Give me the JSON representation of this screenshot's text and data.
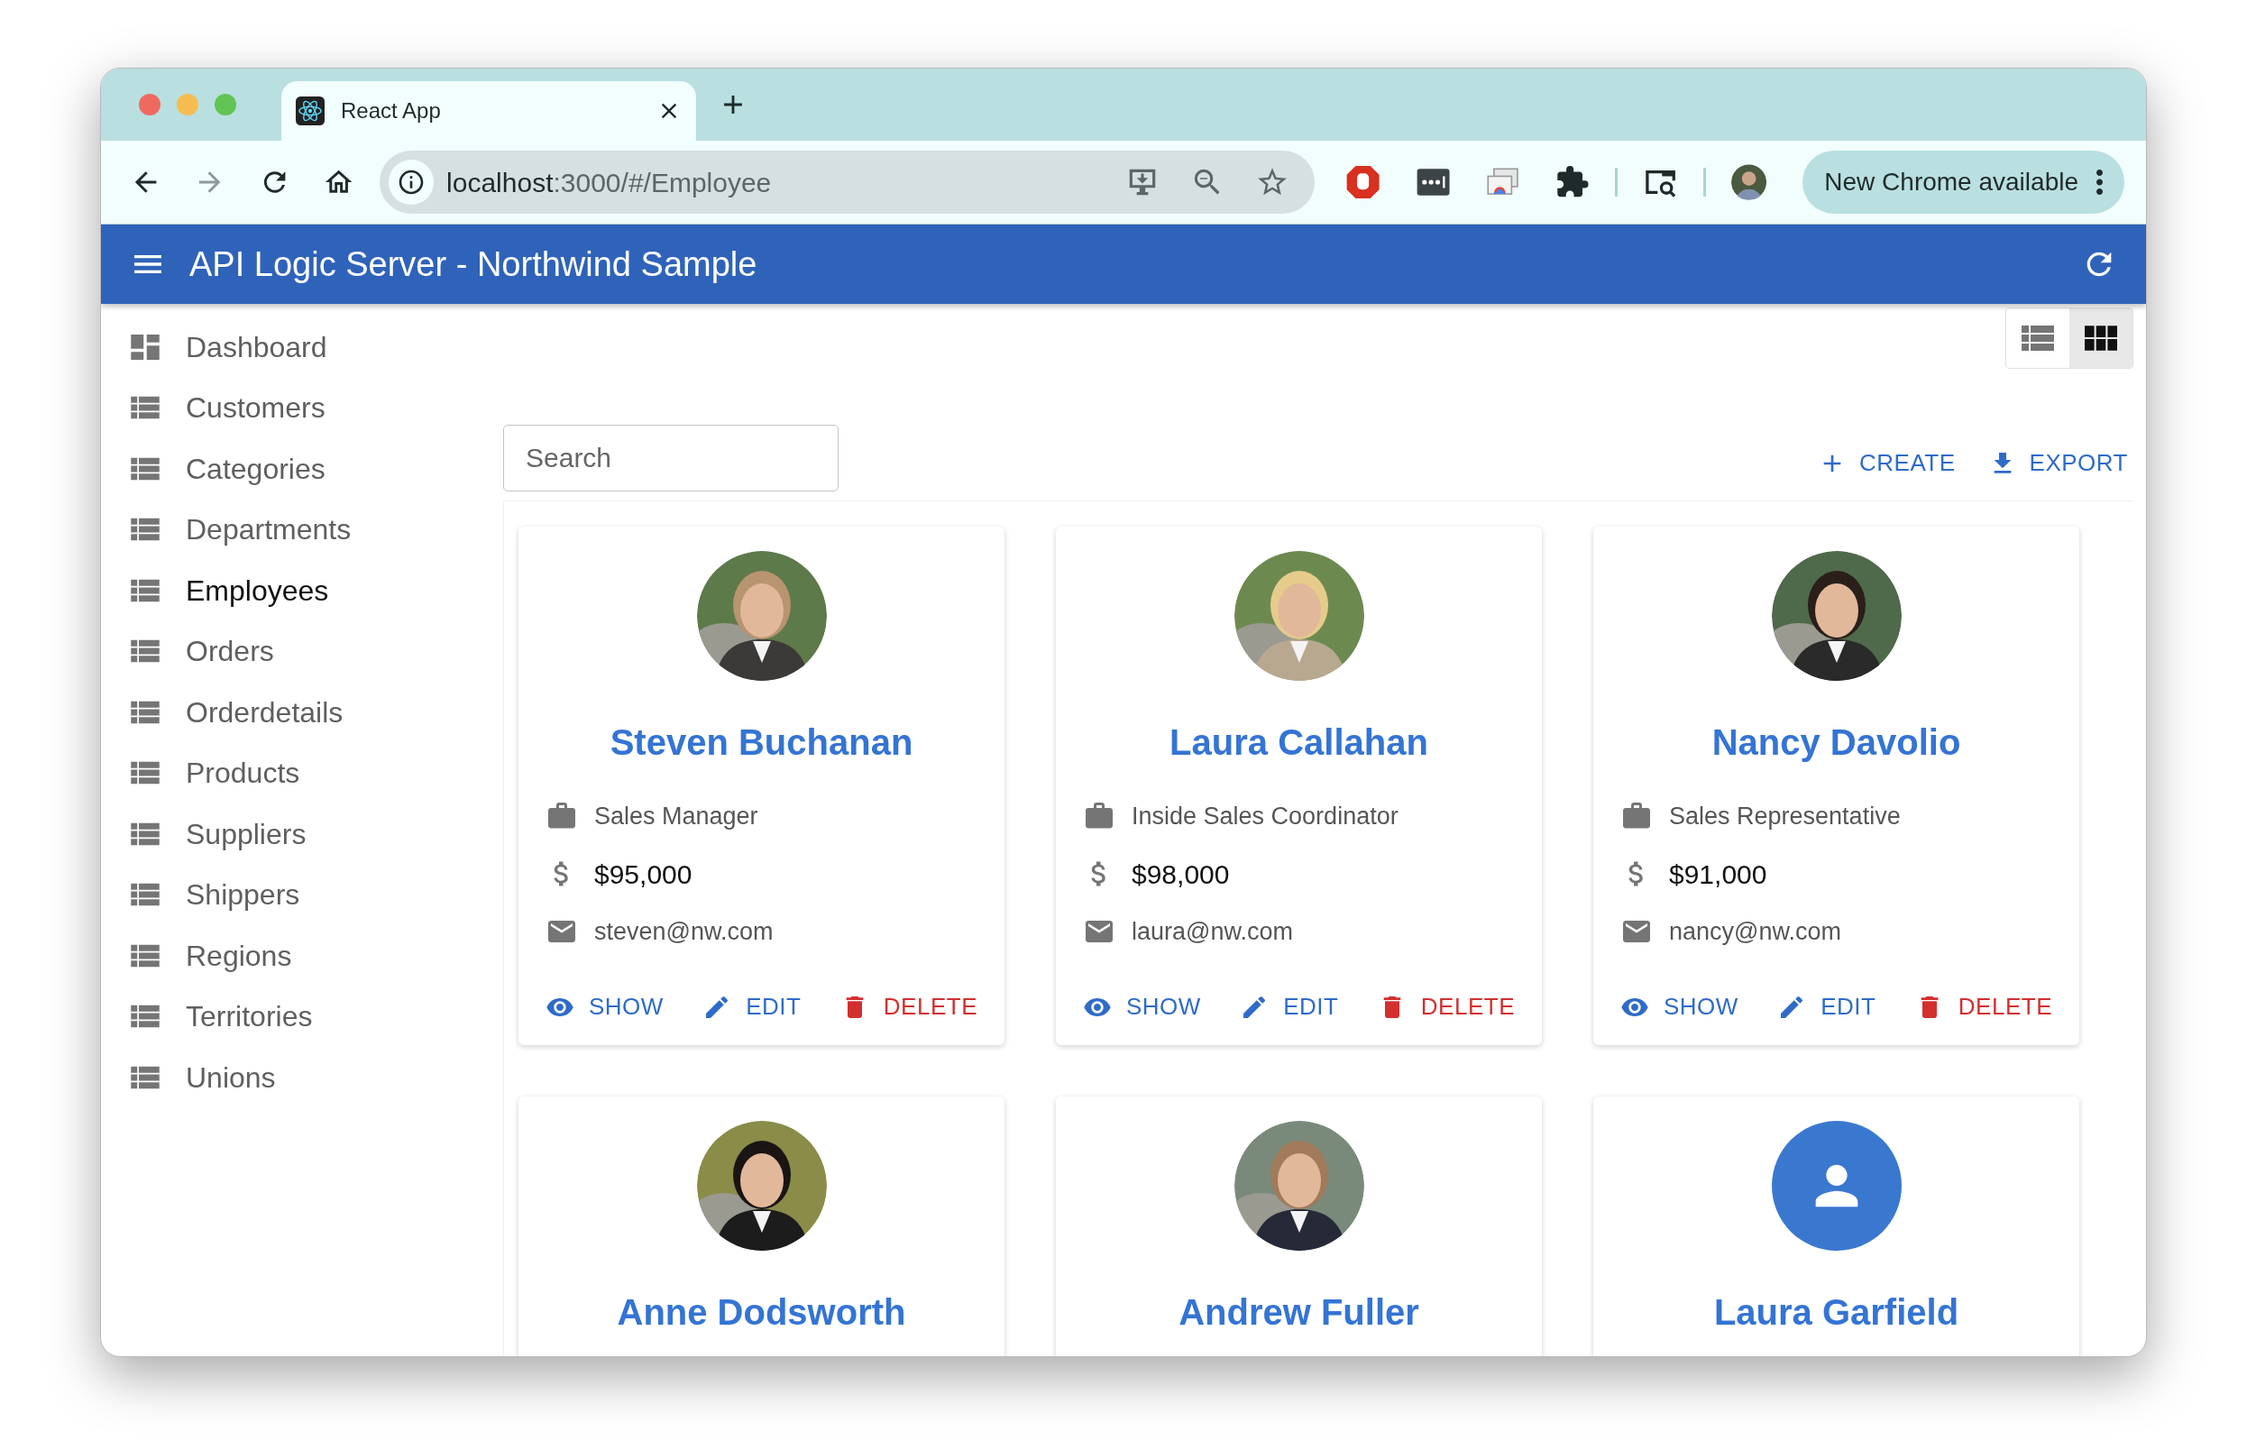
{
  "browser": {
    "tab": {
      "title": "React App"
    },
    "url": {
      "host": "localhost",
      "rest": ":3000/#/Employee"
    },
    "update_button": "New Chrome available"
  },
  "app_bar": {
    "title": "API Logic Server - Northwind Sample"
  },
  "sidebar": {
    "items": [
      {
        "label": "Dashboard",
        "kind": "dashboard",
        "selected": false
      },
      {
        "label": "Customers",
        "kind": "list",
        "selected": false
      },
      {
        "label": "Categories",
        "kind": "list",
        "selected": false
      },
      {
        "label": "Departments",
        "kind": "list",
        "selected": false
      },
      {
        "label": "Employees",
        "kind": "list",
        "selected": true
      },
      {
        "label": "Orders",
        "kind": "list",
        "selected": false
      },
      {
        "label": "Orderdetails",
        "kind": "list",
        "selected": false
      },
      {
        "label": "Products",
        "kind": "list",
        "selected": false
      },
      {
        "label": "Suppliers",
        "kind": "list",
        "selected": false
      },
      {
        "label": "Shippers",
        "kind": "list",
        "selected": false
      },
      {
        "label": "Regions",
        "kind": "list",
        "selected": false
      },
      {
        "label": "Territories",
        "kind": "list",
        "selected": false
      },
      {
        "label": "Unions",
        "kind": "list",
        "selected": false
      }
    ]
  },
  "view_toggle": [
    {
      "kind": "list",
      "selected": false
    },
    {
      "kind": "grid",
      "selected": true
    }
  ],
  "search": {
    "placeholder": "Search"
  },
  "toolbar_actions": [
    {
      "kind": "create",
      "label": "CREATE"
    },
    {
      "kind": "export",
      "label": "EXPORT"
    }
  ],
  "employees": [
    {
      "name": "Steven Buchanan",
      "kind": "picture",
      "title": "Sales Manager",
      "salary": "$95,000",
      "email": "steven@nw.com",
      "actions": [
        {
          "kind": "show",
          "label": "SHOW"
        },
        {
          "kind": "edit",
          "label": "EDIT"
        },
        {
          "kind": "delete",
          "label": "DELETE"
        }
      ]
    },
    {
      "name": "Laura Callahan",
      "kind": "picture",
      "title": "Inside Sales Coordinator",
      "salary": "$98,000",
      "email": "laura@nw.com",
      "actions": [
        {
          "kind": "show",
          "label": "SHOW"
        },
        {
          "kind": "edit",
          "label": "EDIT"
        },
        {
          "kind": "delete",
          "label": "DELETE"
        }
      ]
    },
    {
      "name": "Nancy Davolio",
      "kind": "picture",
      "title": "Sales Representative",
      "salary": "$91,000",
      "email": "nancy@nw.com",
      "actions": [
        {
          "kind": "show",
          "label": "SHOW"
        },
        {
          "kind": "edit",
          "label": "EDIT"
        },
        {
          "kind": "delete",
          "label": "DELETE"
        }
      ]
    },
    {
      "name": "Anne Dodsworth",
      "kind": "picture"
    },
    {
      "name": "Andrew Fuller",
      "kind": "picture"
    },
    {
      "name": "Laura Garfield",
      "kind": "placeholder"
    }
  ]
}
